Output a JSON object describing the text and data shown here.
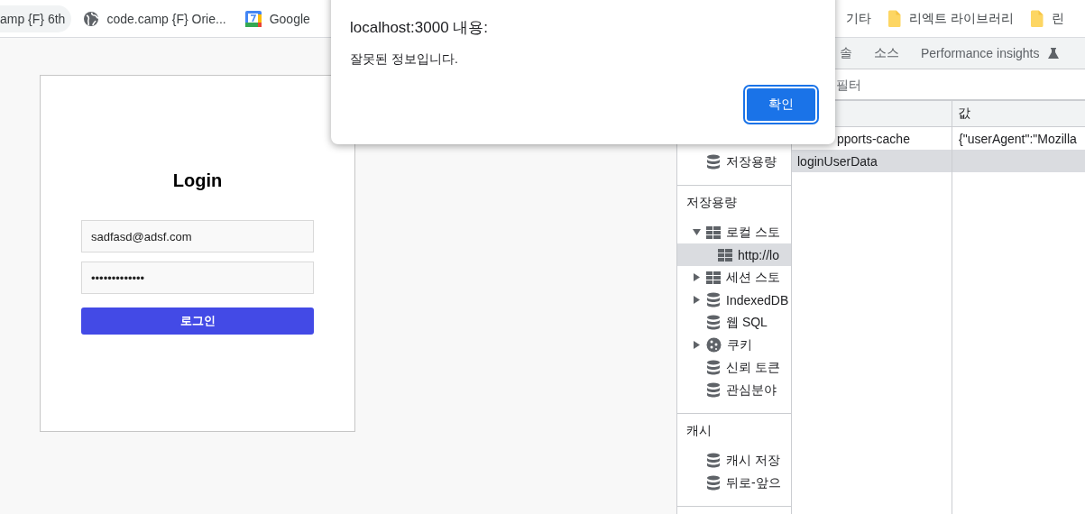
{
  "bookmarks_bar": {
    "left": [
      {
        "label": "amp {F} 6th",
        "kind": "plain",
        "selected": true
      },
      {
        "label": "code.camp {F} Orie...",
        "kind": "site",
        "selected": false
      },
      {
        "label": "Google",
        "kind": "calendar",
        "selected": false
      }
    ],
    "right": [
      {
        "label": "기타",
        "kind": "plain",
        "selected": false
      },
      {
        "label": "리엑트 라이브러리",
        "kind": "folder",
        "selected": false
      },
      {
        "label": "린",
        "kind": "folder",
        "selected": false
      }
    ]
  },
  "login_page": {
    "title": "Login",
    "email": {
      "value": "sadfasd@adsf.com"
    },
    "password": {
      "value": "•••••••••••••"
    },
    "submit": "로그인"
  },
  "devtools": {
    "tabs": [
      {
        "label": "솔",
        "selected": false
      },
      {
        "label": "소스",
        "selected": false
      },
      {
        "label": "Performance insights",
        "kind": "experimental",
        "selected": false
      }
    ],
    "filter": {
      "placeholder": "필터"
    },
    "sidebar": {
      "top_items": [
        {
          "label": "저장용량",
          "kind": "store",
          "selected": false
        }
      ],
      "sections": [
        {
          "title": "저장용량",
          "items": [
            {
              "label": "로컬 스토",
              "kind": "table",
              "expanded": true,
              "selected": false,
              "children": [
                {
                  "label": "http://lo",
                  "kind": "table",
                  "selected": true
                }
              ]
            },
            {
              "label": "세션 스토",
              "kind": "table",
              "expanded": false,
              "selected": false
            },
            {
              "label": "IndexedDB",
              "kind": "store",
              "expanded": false,
              "selected": false
            },
            {
              "label": "웹 SQL",
              "kind": "store",
              "selected": false
            },
            {
              "label": "쿠키",
              "kind": "cookie",
              "expanded": false,
              "selected": false
            },
            {
              "label": "신뢰 토큰",
              "kind": "store",
              "selected": false
            },
            {
              "label": "관심분야",
              "kind": "store",
              "selected": false
            }
          ]
        },
        {
          "title": "캐시",
          "items": [
            {
              "label": "캐시 저장",
              "kind": "store",
              "selected": false
            },
            {
              "label": "뒤로-앞으",
              "kind": "store",
              "selected": false
            }
          ]
        }
      ]
    },
    "table": {
      "value_column": {
        "label": "값"
      },
      "rows": [
        {
          "key": "pports-cache",
          "value": "{\"userAgent\":\"Mozilla",
          "selected": false
        },
        {
          "key": "loginUserData",
          "selected": true
        }
      ]
    }
  },
  "alert_dialog": {
    "title": "localhost:3000 내용:",
    "message": "잘못된 정보입니다.",
    "button": "확인"
  }
}
